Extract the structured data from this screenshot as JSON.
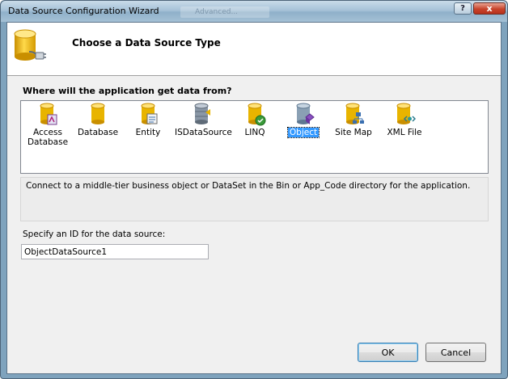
{
  "window": {
    "title": "Data Source Configuration Wizard",
    "ghost_tab": "Advanced...",
    "help_label": "?",
    "close_label": "x"
  },
  "header": {
    "title": "Choose a Data Source Type"
  },
  "source_types": {
    "question": "Where will the application get data from?",
    "items": [
      {
        "label": "Access Database",
        "icon": "access-database-icon",
        "selected": false
      },
      {
        "label": "Database",
        "icon": "database-icon",
        "selected": false
      },
      {
        "label": "Entity",
        "icon": "entity-icon",
        "selected": false
      },
      {
        "label": "ISDataSource",
        "icon": "isdatasource-icon",
        "selected": false
      },
      {
        "label": "LINQ",
        "icon": "linq-icon",
        "selected": false
      },
      {
        "label": "Object",
        "icon": "object-icon",
        "selected": true
      },
      {
        "label": "Site Map",
        "icon": "site-map-icon",
        "selected": false
      },
      {
        "label": "XML File",
        "icon": "xml-file-icon",
        "selected": false
      }
    ],
    "description": "Connect to a middle-tier business object or DataSet in the Bin or App_Code directory for the application."
  },
  "id_field": {
    "label": "Specify an ID for the data source:",
    "value": "ObjectDataSource1"
  },
  "buttons": {
    "ok": "OK",
    "cancel": "Cancel"
  },
  "colors": {
    "selection": "#3399ff",
    "cylinder": "#e8b400"
  }
}
